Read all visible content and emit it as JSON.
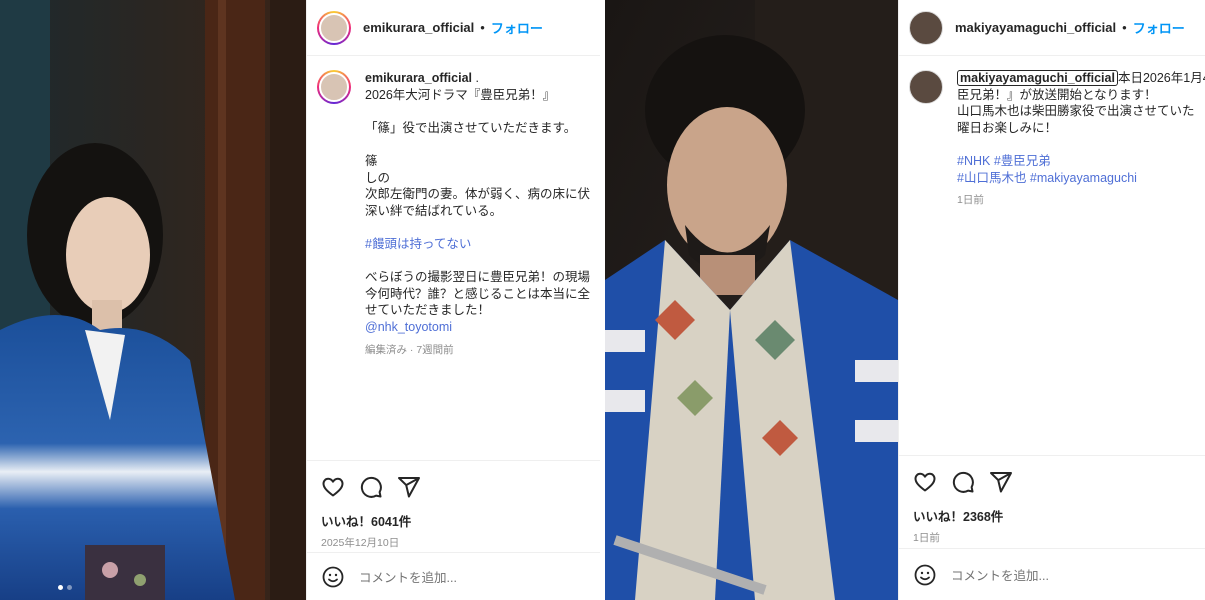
{
  "left_post": {
    "username": "emikurara_official",
    "dot": "•",
    "follow": "フォロー",
    "caption_user": "emikurara_official",
    "caption_user_suffix": " .",
    "caption_lines": [
      "2026年大河ドラマ『豊臣兄弟！』",
      "",
      "「篠」役で出演させていただきます。",
      "",
      "篠",
      "しの",
      "次郎左衛門の妻。体が弱く、病の床に伏",
      "深い絆で結ばれている。",
      "",
      "#饅頭は持ってない",
      "",
      "べらぼうの撮影翌日に豊臣兄弟！の現場",
      "今何時代？誰？と感じることは本当に全",
      "せていただきました！",
      "@nhk_toyotomi"
    ],
    "meta": "編集済み · 7週間前",
    "likes": "いいね！6041件",
    "date": "2025年12月10日",
    "comment_placeholder": "コメントを追加..."
  },
  "right_post": {
    "username": "makiyayamaguchi_official",
    "dot": "•",
    "follow": "フォロー",
    "caption_user": "makiyayamaguchi_official",
    "caption_first_rest": "本日2026年1月4",
    "caption_lines": [
      "臣兄弟！』が放送開始となります！",
      "山口馬木也は柴田勝家役で出演させていた",
      "曜日お楽しみに！",
      "",
      "#NHK #豊臣兄弟",
      "#山口馬木也 #makiyayamaguchi"
    ],
    "meta": "1日前",
    "likes": "いいね！2368件",
    "date": "1日前",
    "comment_placeholder": "コメントを追加..."
  },
  "icons": {
    "heart": "heart-icon",
    "comment": "comment-icon",
    "share": "share-icon",
    "emoji": "emoji-icon"
  },
  "colors": {
    "follow": "#0095f6",
    "hashtag": "#4f6fd6",
    "muted": "#8e8e8e"
  }
}
